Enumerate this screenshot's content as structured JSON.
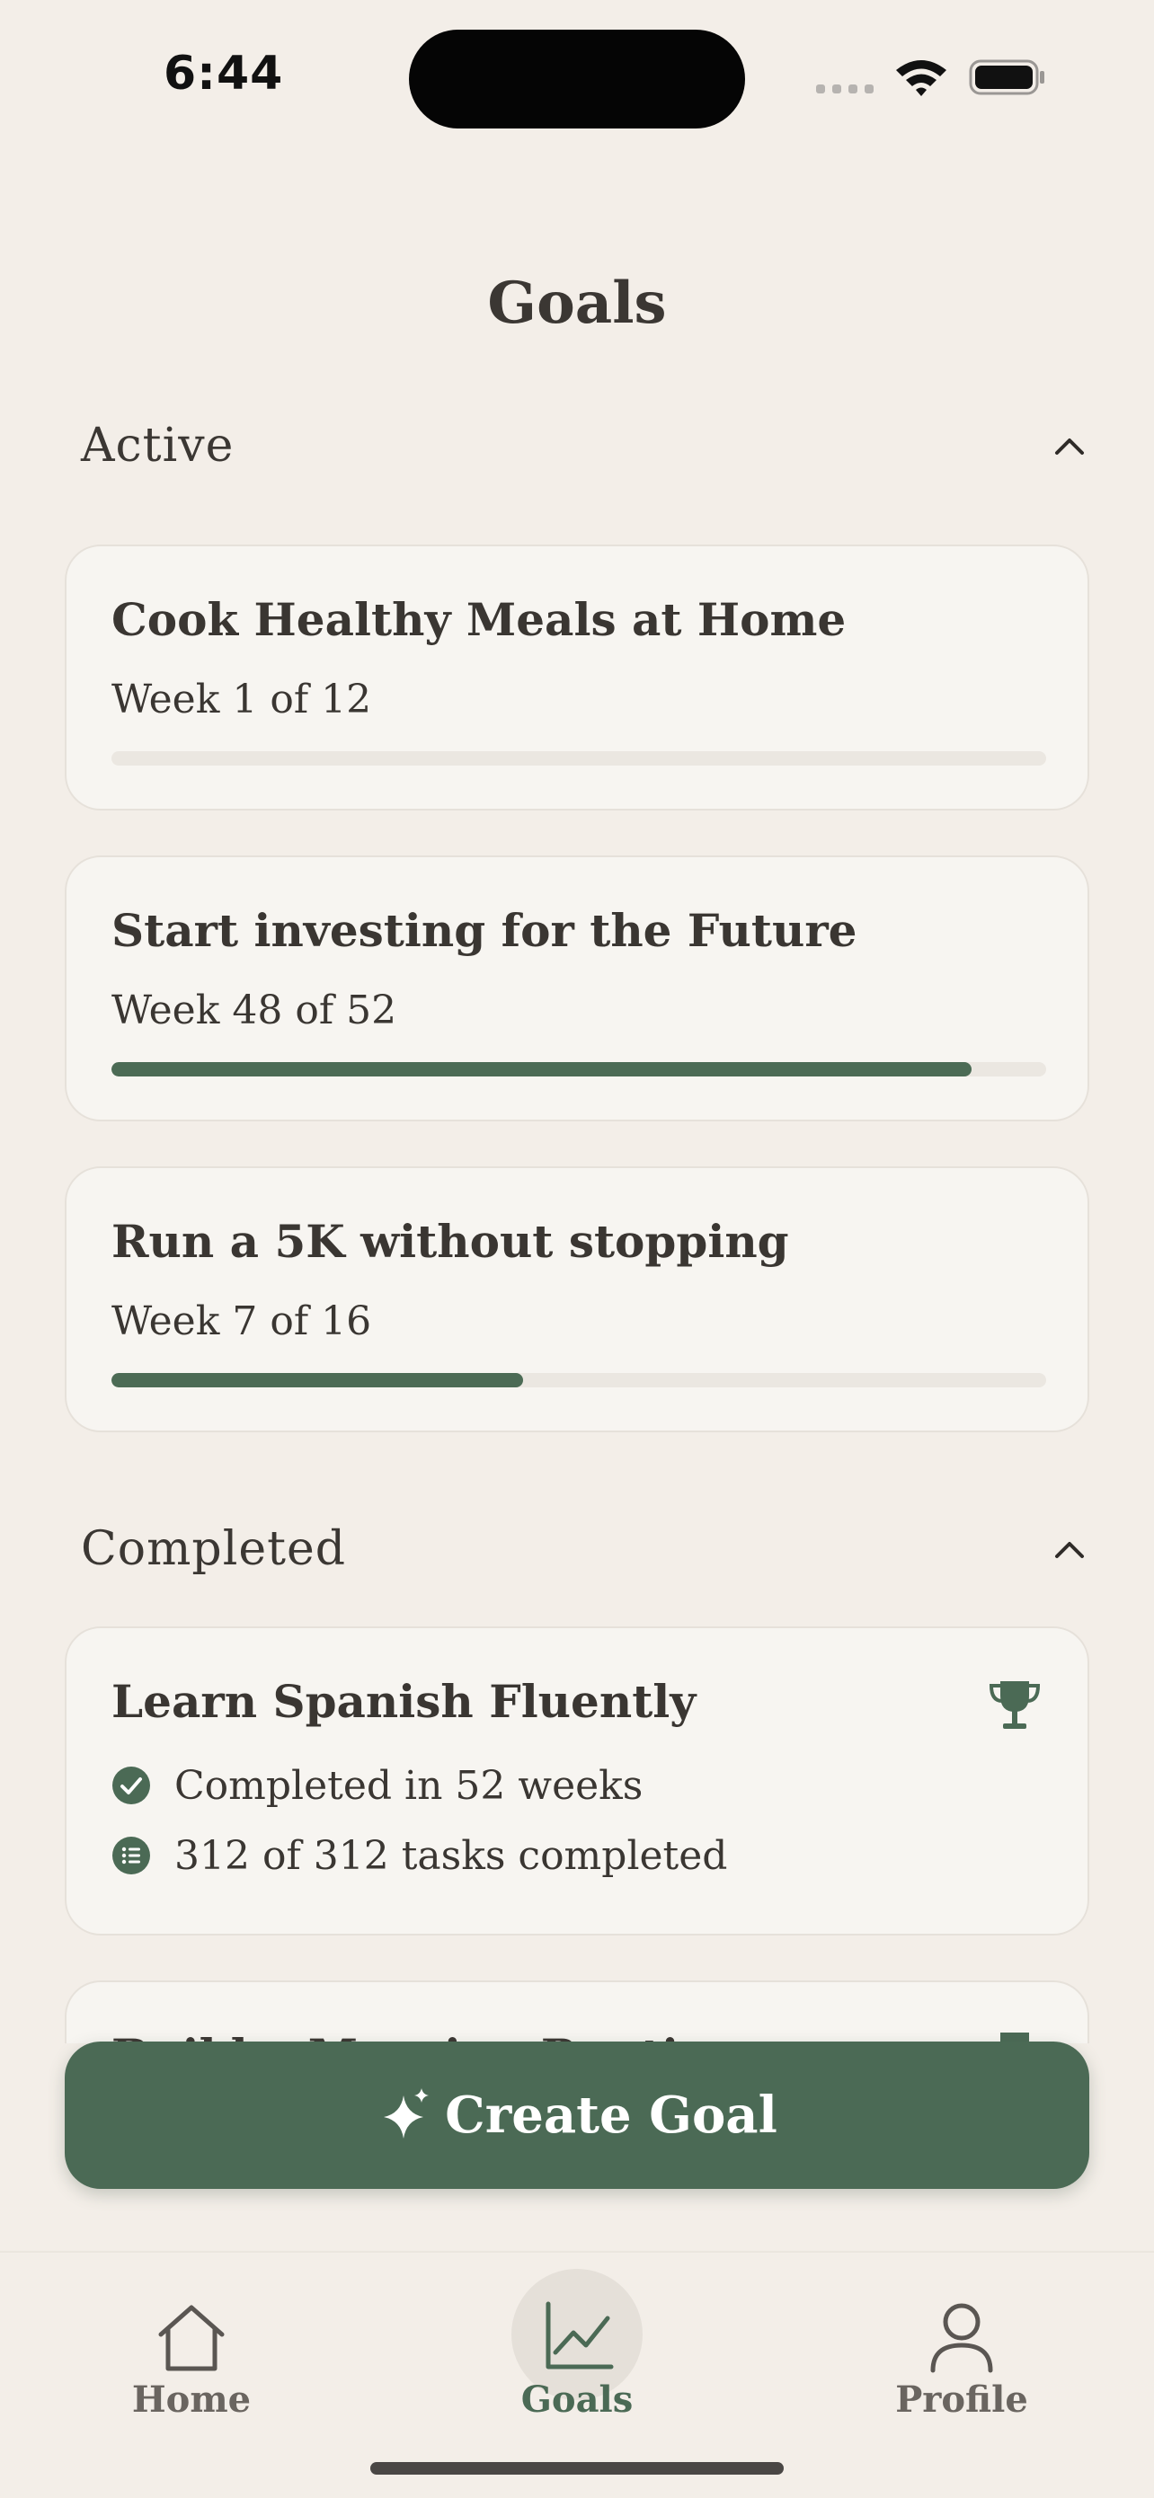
{
  "status_bar": {
    "time": "6:44"
  },
  "header": {
    "title": "Goals"
  },
  "sections": {
    "active": {
      "title": "Active"
    },
    "completed": {
      "title": "Completed"
    }
  },
  "active_goals": [
    {
      "title": "Cook Healthy Meals at Home",
      "progress_text": "Week 1 of 12",
      "progress": 0.0
    },
    {
      "title": "Start investing for the Future",
      "progress_text": "Week 48 of 52",
      "progress": 0.92
    },
    {
      "title": "Run a 5K without stopping",
      "progress_text": "Week 7 of 16",
      "progress": 0.44
    }
  ],
  "completed_goals": [
    {
      "title": "Learn Spanish Fluently",
      "duration_text": "Completed in 52 weeks",
      "tasks_text": "312 of 312 tasks completed",
      "icon": "trophy-icon"
    },
    {
      "title": "Build a Morning Routine",
      "icon": "trophy-icon"
    }
  ],
  "create_button": {
    "label": "Create Goal",
    "icon": "sparkle-icon"
  },
  "tab_bar": {
    "items": [
      {
        "label": "Home",
        "icon": "home-icon",
        "active": false
      },
      {
        "label": "Goals",
        "icon": "chart-icon",
        "active": true
      },
      {
        "label": "Profile",
        "icon": "person-icon",
        "active": false
      }
    ]
  },
  "colors": {
    "accent": "#4b6a55",
    "background": "#f3eee8",
    "card": "#f7f5f1",
    "text": "#3a3632"
  }
}
